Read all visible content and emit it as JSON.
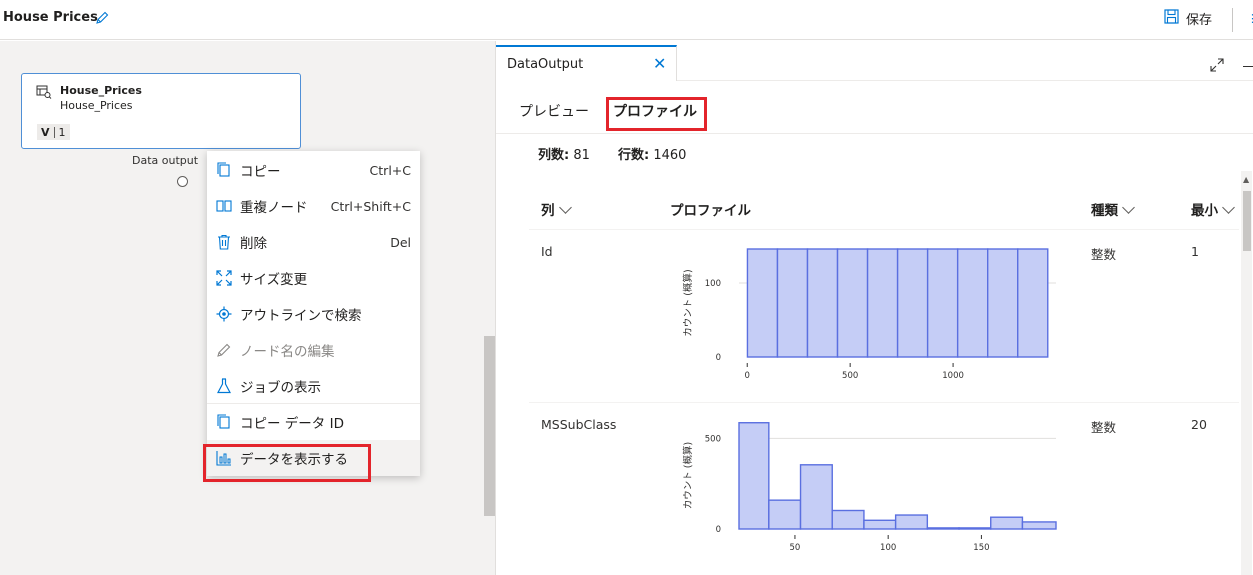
{
  "header": {
    "title": "House Prices",
    "save_label": "保存"
  },
  "node": {
    "title": "House_Prices",
    "subtitle": "House_Prices",
    "version_prefix": "V",
    "version": "1",
    "port_label": "Data output"
  },
  "context_menu": {
    "items": [
      {
        "icon": "copy-icon",
        "label": "コピー",
        "shortcut": "Ctrl+C"
      },
      {
        "icon": "duplicate-icon",
        "label": "重複ノード",
        "shortcut": "Ctrl+Shift+C"
      },
      {
        "icon": "delete-icon",
        "label": "削除",
        "shortcut": "Del"
      },
      {
        "icon": "resize-icon",
        "label": "サイズ変更",
        "shortcut": ""
      },
      {
        "icon": "locate-icon",
        "label": "アウトラインで検索",
        "shortcut": ""
      },
      {
        "icon": "pencil-icon",
        "label": "ノード名の編集",
        "shortcut": "",
        "disabled": true
      },
      {
        "icon": "flask-icon",
        "label": "ジョブの表示",
        "shortcut": ""
      },
      {
        "icon": "copy-data-icon",
        "label": "コピー データ ID",
        "shortcut": ""
      },
      {
        "icon": "bar-chart-icon",
        "label": "データを表示する",
        "shortcut": "",
        "highlighted": true
      }
    ]
  },
  "panel": {
    "tab_label": "DataOutput",
    "subtabs": [
      "プレビュー",
      "プロファイル"
    ],
    "active_subtab": "プロファイル",
    "columns_count_label": "列数:",
    "columns_count": "81",
    "rows_count_label": "行数:",
    "rows_count": "1460",
    "table_headers": {
      "column": "列",
      "profile": "プロファイル",
      "type": "種類",
      "min": "最小"
    },
    "rows": [
      {
        "name": "Id",
        "type": "整数",
        "min": "1"
      },
      {
        "name": "MSSubClass",
        "type": "整数",
        "min": "20"
      }
    ]
  },
  "colors": {
    "accent": "#0078d4",
    "highlight_box": "#e3242b",
    "bar_fill": "#c5cdf6",
    "bar_stroke": "#5a6fe0"
  },
  "chart_data": [
    {
      "type": "bar",
      "title": "",
      "xlabel": "",
      "ylabel": "カウント (概算)",
      "bin_edges": [
        1,
        146.9,
        292.8,
        438.7,
        584.6,
        730.5,
        876.4,
        1022.3,
        1168.2,
        1314.1,
        1460
      ],
      "values": [
        146,
        146,
        146,
        146,
        146,
        146,
        146,
        146,
        146,
        146
      ],
      "x_ticks": [
        "0",
        "500",
        "1000"
      ],
      "y_ticks": [
        "0",
        "100"
      ],
      "xlim": [
        -40,
        1500
      ],
      "ylim": [
        0,
        146
      ]
    },
    {
      "type": "bar",
      "title": "",
      "xlabel": "",
      "ylabel": "カウント (概算)",
      "bin_edges": [
        20,
        36,
        53,
        70,
        87,
        104,
        121,
        138,
        155,
        172,
        190
      ],
      "values": [
        586,
        159,
        354,
        102,
        48,
        77,
        6,
        6,
        65,
        39
      ],
      "x_ticks": [
        "50",
        "100",
        "150"
      ],
      "y_ticks": [
        "0",
        "500"
      ],
      "xlim": [
        20,
        190
      ],
      "ylim": [
        0,
        590
      ]
    }
  ]
}
